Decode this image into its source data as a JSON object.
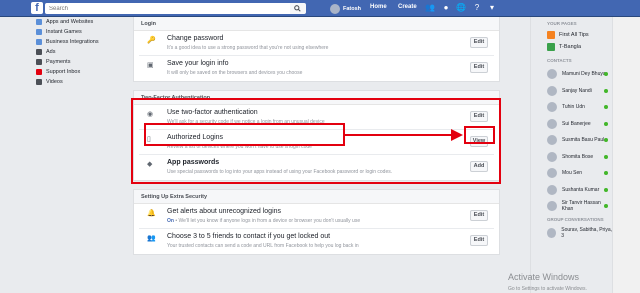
{
  "topbar": {
    "logo": "f",
    "search_placeholder": "Search",
    "user_name": "Fatosh",
    "home": "Home",
    "create": "Create"
  },
  "left_sidebar": {
    "items": [
      {
        "label": "Apps and Websites",
        "color": "#5b8fd8"
      },
      {
        "label": "Instant Games",
        "color": "#5b8fd8"
      },
      {
        "label": "Business Integrations",
        "color": "#5b8fd8"
      },
      {
        "label": "Ads",
        "color": "#4b4f56"
      },
      {
        "label": "Payments",
        "color": "#4b4f56"
      },
      {
        "label": "Support Inbox",
        "color": "#e3000f"
      },
      {
        "label": "Videos",
        "color": "#4b4f56"
      }
    ]
  },
  "login": {
    "heading": "Login",
    "rows": [
      {
        "title": "Change password",
        "desc": "It's a good idea to use a strong password that you're not using elsewhere",
        "button": "Edit"
      },
      {
        "title": "Save your login info",
        "desc": "It will only be saved on the browsers and devices you choose",
        "button": "Edit"
      }
    ]
  },
  "two_factor": {
    "heading": "Two-Factor Authentication",
    "rows": [
      {
        "title": "Use two-factor authentication",
        "desc": "We'll ask for a security code if we notice a login from an unusual device",
        "button": "Edit"
      },
      {
        "title": "Authorized Logins",
        "desc": "Review a list of devices where you won't have to use a login code",
        "button": "View"
      },
      {
        "title": "App passwords",
        "desc": "Use special passwords to log into your apps instead of using your Facebook password or login codes.",
        "button": "Add"
      }
    ]
  },
  "extra": {
    "heading": "Setting Up Extra Security",
    "rows": [
      {
        "title": "Get alerts about unrecognized logins",
        "desc_prefix": "On",
        "desc": " • We'll let you know if anyone logs in from a device or browser you don't usually use",
        "button": "Edit"
      },
      {
        "title": "Choose 3 to 5 friends to contact if you get locked out",
        "desc": "Your trusted contacts can send a code and URL from Facebook to help you log back in",
        "button": "Edit"
      }
    ]
  },
  "right": {
    "pages_heading": "YOUR PAGES",
    "pages": [
      {
        "name": "First All Tips",
        "color": "#f58220"
      },
      {
        "name": "T-Bangla",
        "color": "#3aa14b"
      }
    ],
    "contacts_heading": "CONTACTS",
    "contacts": [
      {
        "name": "Mamuni Dey Bhuya"
      },
      {
        "name": "Sanjay Nandi"
      },
      {
        "name": "Tuhin Udn"
      },
      {
        "name": "Sui Banerjee"
      },
      {
        "name": "Susmita Basu Paul"
      },
      {
        "name": "Shomita Bose"
      },
      {
        "name": "Mou Sen"
      },
      {
        "name": "Sushanta Kumar"
      },
      {
        "name": "Sir Tanvir Hassan Khan"
      }
    ],
    "group_heading": "GROUP CONVERSATIONS",
    "group_item": "Sourav, Sabitha, Priya, 3"
  },
  "watermark": {
    "line1": "Activate Windows",
    "line2": "Go to Settings to activate Windows."
  }
}
